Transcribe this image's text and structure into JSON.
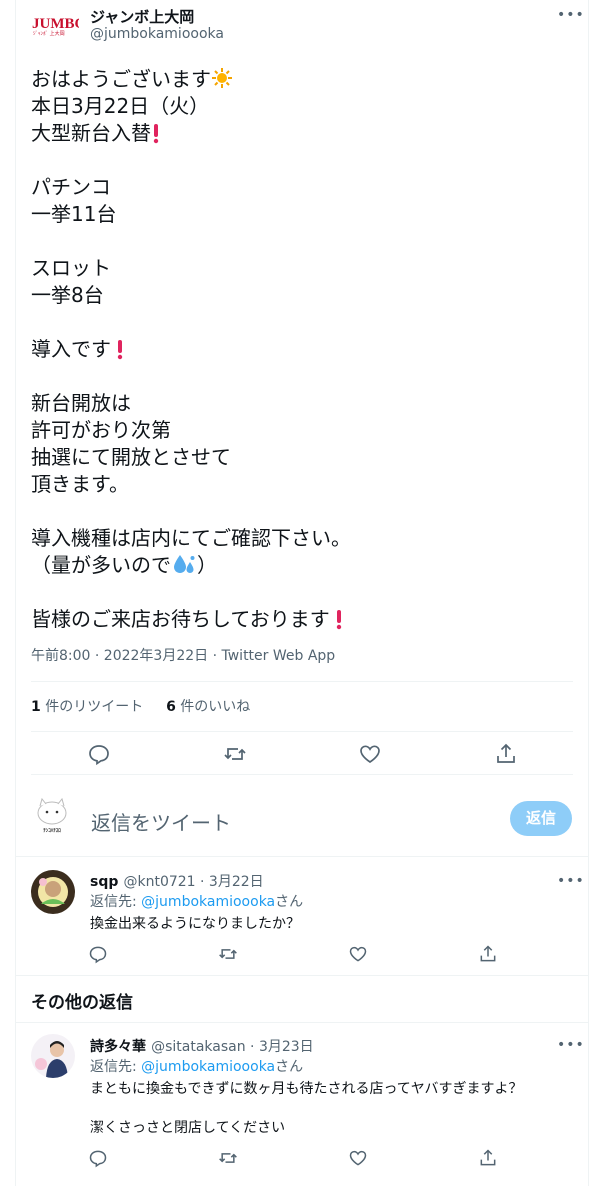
{
  "author": {
    "name": "ジャンボ上大岡",
    "handle": "@jumbokamioooka",
    "logo_text": "JUMBO"
  },
  "tweet": {
    "lines": [
      "おはようございます",
      "本日3月22日（火）",
      "大型新台入替",
      "",
      "パチンコ",
      "一挙11台",
      "",
      "スロット",
      "一挙8台",
      "",
      "導入です",
      "",
      "新台開放は",
      "許可がおり次第",
      "抽選にて開放とさせて",
      "頂きます。",
      "",
      "導入機種は店内にてご確認下さい。",
      "（量が多いので",
      "",
      "皆様のご来店お待ちしております"
    ],
    "paren_close": "）",
    "meta": "午前8:00 · 2022年3月22日 · Twitter Web App"
  },
  "stats": {
    "retweet_count": "1",
    "retweet_label": " 件のリツイート",
    "like_count": "6",
    "like_label": " 件のいいね"
  },
  "actions": [
    "reply-icon",
    "retweet-icon",
    "like-icon",
    "share-icon"
  ],
  "compose": {
    "placeholder": "返信をツイート",
    "button": "返信"
  },
  "comments": [
    {
      "name": "sqp",
      "handle_date": "@knt0721 · 3月22日",
      "replyto_prefix": "返信先: ",
      "replyto_mention": "@jumbokamioooka",
      "replyto_suffix": "さん",
      "text": [
        "換金出来るようになりましたか？"
      ]
    },
    {
      "name": "詩多々華",
      "handle_date": "@sitatakasan · 3月23日",
      "replyto_prefix": "返信先: ",
      "replyto_mention": "@jumbokamioooka",
      "replyto_suffix": "さん",
      "text": [
        "まともに換金もできずに数ヶ月も待たされる店ってヤバすぎますよ？",
        "",
        "潔くさっさと閉店してください"
      ]
    }
  ],
  "section_title": "その他の返信",
  "colors": {
    "accent": "#1d9bf0",
    "reply_button": "#8ecdf8",
    "text": "#0f1419",
    "muted": "#536471",
    "excl": "#e0245e"
  }
}
